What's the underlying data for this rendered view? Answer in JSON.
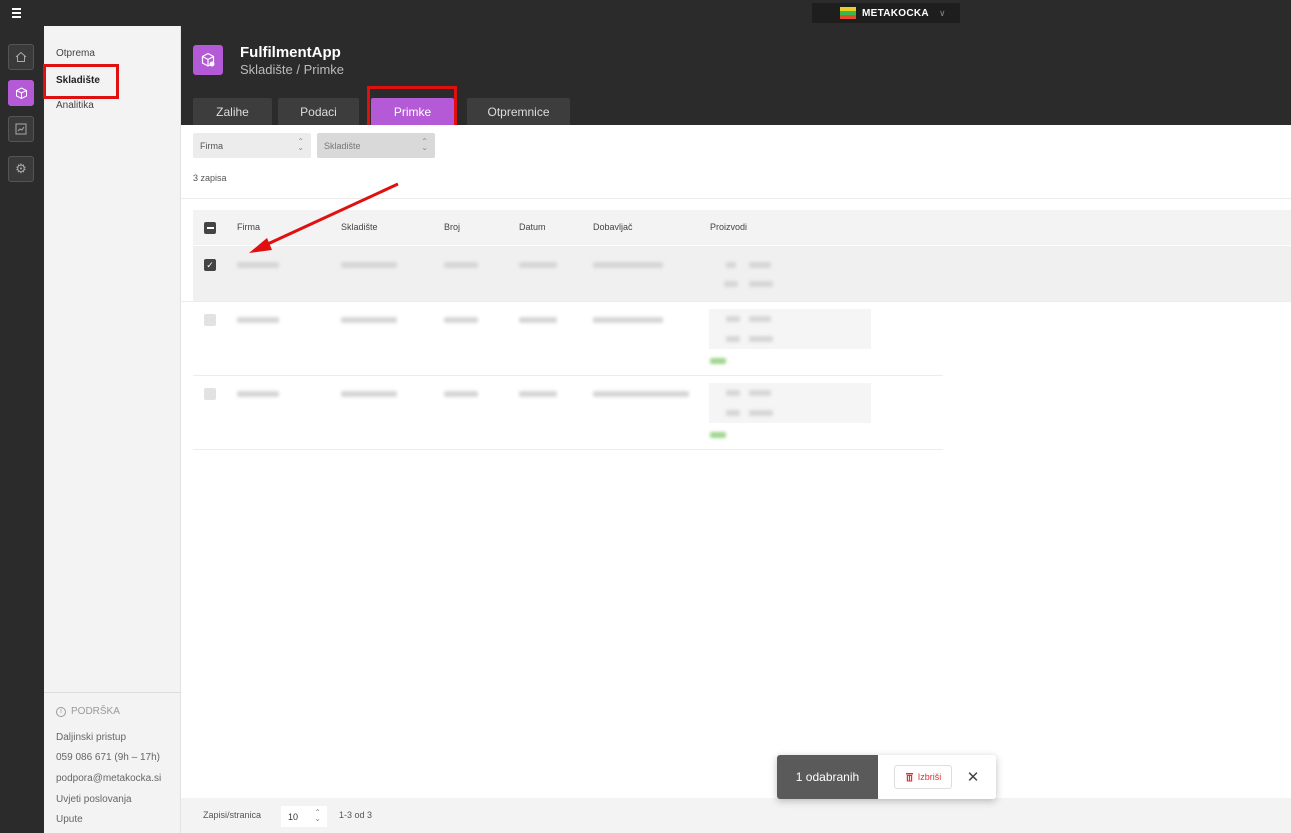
{
  "topbar": {
    "brand": "METAKOCKA",
    "brand_colors": [
      "#e8d020",
      "#3cb84a",
      "#e84a2c"
    ]
  },
  "accent": "#b45ad6",
  "highlight": "#e01010",
  "sidebar": {
    "items": [
      {
        "label": "Otprema"
      },
      {
        "label": "Skladište"
      },
      {
        "label": "Analitika"
      }
    ],
    "support": {
      "title": "PODRŠKA",
      "lines": [
        "Daljinski pristup",
        "059 086 671 (9h – 17h)",
        "podpora@metakocka.si",
        "Uvjeti poslovanja",
        "Upute"
      ]
    }
  },
  "header": {
    "title": "FulfilmentApp",
    "breadcrumb": "Skladište / Primke",
    "tabs": [
      {
        "label": "Zalihe"
      },
      {
        "label": "Podaci"
      },
      {
        "label": "Primke"
      },
      {
        "label": "Otpremnice"
      }
    ]
  },
  "filters": {
    "firma": "Firma",
    "skladiste": "Skladište"
  },
  "records_count": "3 zapisa",
  "table": {
    "headers": [
      "Firma",
      "Skladište",
      "Broj",
      "Datum",
      "Dobavljač",
      "Proizvodi"
    ]
  },
  "pagination": {
    "label": "Zapisi/stranica",
    "per_page": "10",
    "range": "1-3 od 3"
  },
  "toast": {
    "selected": "1 odabranih",
    "delete": "Izbriši"
  }
}
